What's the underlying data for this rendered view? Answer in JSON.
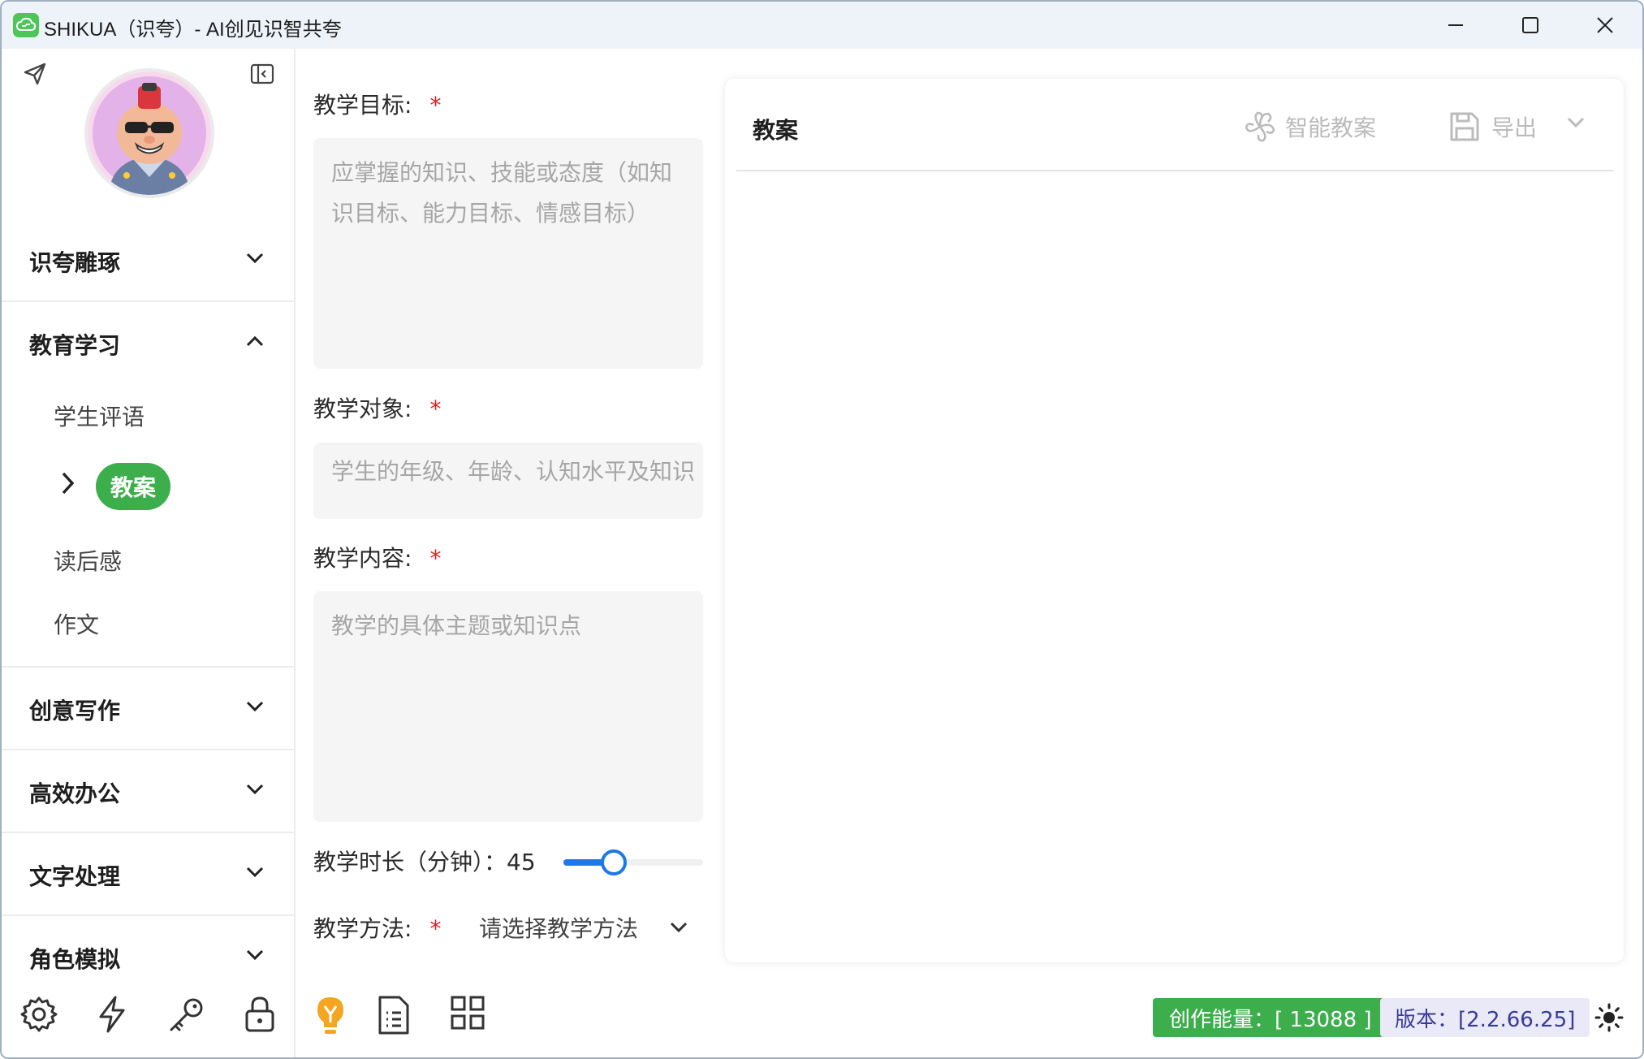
{
  "window": {
    "title": "SHIKUA（识夸）- AI创见识智共夸"
  },
  "sidebar": {
    "sections": [
      {
        "label": "识夸雕琢",
        "expanded": false
      },
      {
        "label": "教育学习",
        "expanded": true
      },
      {
        "label": "创意写作",
        "expanded": false
      },
      {
        "label": "高效办公",
        "expanded": false
      },
      {
        "label": "文字处理",
        "expanded": false
      },
      {
        "label": "角色模拟",
        "expanded": false
      }
    ],
    "education_items": [
      {
        "label": "学生评语"
      },
      {
        "label": "教案",
        "active": true
      },
      {
        "label": "读后感"
      },
      {
        "label": "作文"
      }
    ],
    "bottom_icons": [
      "settings-icon",
      "lightning-icon",
      "key-icon",
      "lock-icon"
    ]
  },
  "form": {
    "objective": {
      "label": "教学目标:",
      "required": "*",
      "placeholder": "应掌握的知识、技能或态度（如知识目标、能力目标、情感目标）"
    },
    "audience": {
      "label": "教学对象:",
      "required": "*",
      "placeholder": "学生的年级、年龄、认知水平及知识"
    },
    "content": {
      "label": "教学内容:",
      "required": "*",
      "placeholder": "教学的具体主题或知识点"
    },
    "duration": {
      "label": "教学时长（分钟）：",
      "value": "45",
      "slider_fraction": 0.36
    },
    "method": {
      "label": "教学方法:",
      "required": "*",
      "value": "请选择教学方法"
    },
    "tool_icons": [
      "lightbulb-icon",
      "document-list-icon",
      "grid-icon"
    ]
  },
  "panel": {
    "title": "教案",
    "smart_button": "智能教案",
    "export_button": "导出"
  },
  "footer": {
    "energy": "创作能量：[ 13088 ]",
    "version": "版本：[2.2.66.25]"
  },
  "colors": {
    "accent_green": "#3cae4b",
    "slider_blue": "#1e78e6",
    "required_red": "#e02020"
  }
}
